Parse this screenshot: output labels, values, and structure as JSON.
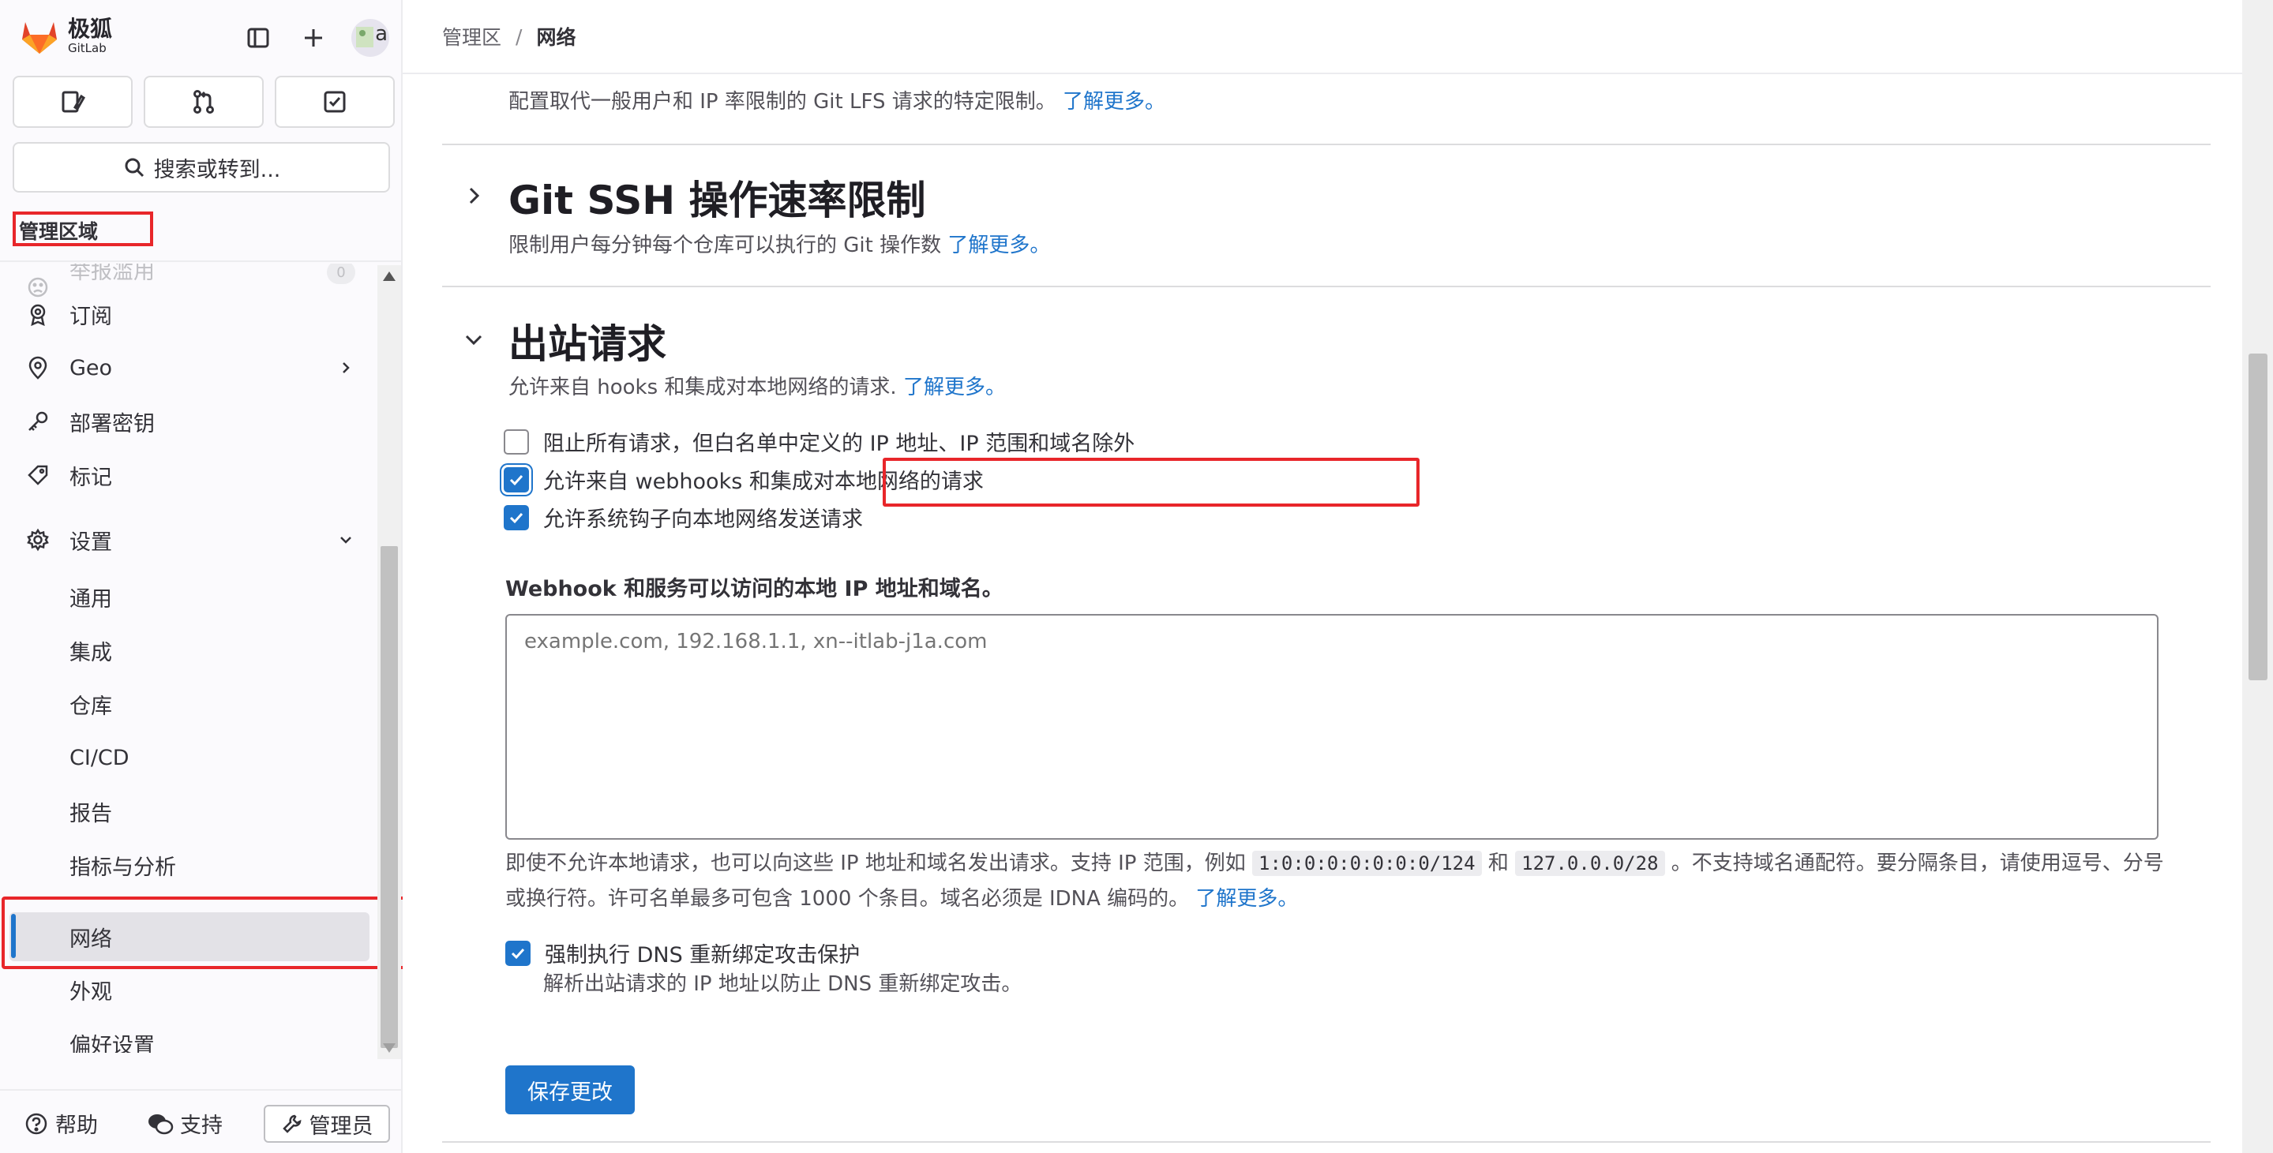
{
  "brand": {
    "name_cn": "极狐",
    "name_en": "GitLab"
  },
  "avatar_text": "a",
  "search": {
    "label": "搜索或转到..."
  },
  "sidebar": {
    "section_title": "管理区域",
    "items": [
      {
        "label": "举报滥用",
        "badge": "0"
      },
      {
        "label": "订阅"
      },
      {
        "label": "Geo"
      },
      {
        "label": "部署密钥"
      },
      {
        "label": "标记"
      },
      {
        "label": "设置"
      },
      {
        "label": "通用"
      },
      {
        "label": "集成"
      },
      {
        "label": "仓库"
      },
      {
        "label": "CI/CD"
      },
      {
        "label": "报告"
      },
      {
        "label": "指标与分析"
      },
      {
        "label": "网络"
      },
      {
        "label": "外观"
      },
      {
        "label": "偏好设置"
      }
    ],
    "footer": {
      "help": "帮助",
      "support": "支持",
      "admin": "管理员"
    }
  },
  "breadcrumb": {
    "root": "管理区",
    "separator": "/",
    "current": "网络"
  },
  "lfs": {
    "description": "配置取代一般用户和 IP 率限制的 Git LFS 请求的特定限制。",
    "learn_more": "了解更多。"
  },
  "ssh": {
    "title": "Git SSH 操作速率限制",
    "description": "限制用户每分钟每个仓库可以执行的 Git 操作数",
    "learn_more": "了解更多。"
  },
  "outbound": {
    "title": "出站请求",
    "description": "允许来自 hooks 和集成对本地网络的请求.",
    "learn_more": "了解更多。",
    "checkboxes": [
      {
        "label": "阻止所有请求，但白名单中定义的 IP 地址、IP 范围和域名除外",
        "checked": false
      },
      {
        "label": "允许来自 webhooks 和集成对本地网络的请求",
        "checked": true
      },
      {
        "label": "允许系统钩子向本地网络发送请求",
        "checked": true
      }
    ],
    "allowlist_label": "Webhook 和服务可以访问的本地 IP 地址和域名。",
    "allowlist_placeholder": "example.com, 192.168.1.1, xn--itlab-j1a.com",
    "help_part1": "即使不允许本地请求，也可以向这些 IP 地址和域名发出请求。支持 IP 范围，例如",
    "code1": "1:0:0:0:0:0:0:0/124",
    "help_and": "和",
    "code2": "127.0.0.0/28",
    "help_part2": "。不支持域名通配符。要分隔条目，请使用逗号、分号或换行符。许可名单最多可包含 1000 个条目。域名必须是 IDNA 编码的。",
    "help_learn_more": "了解更多。",
    "dns": {
      "label": "强制执行 DNS 重新绑定攻击保护",
      "checked": true,
      "help": "解析出站请求的 IP 地址以防止 DNS 重新绑定攻击。"
    },
    "save": "保存更改"
  },
  "colors": {
    "accent": "#1f75cb",
    "highlight": "#e8262a"
  }
}
